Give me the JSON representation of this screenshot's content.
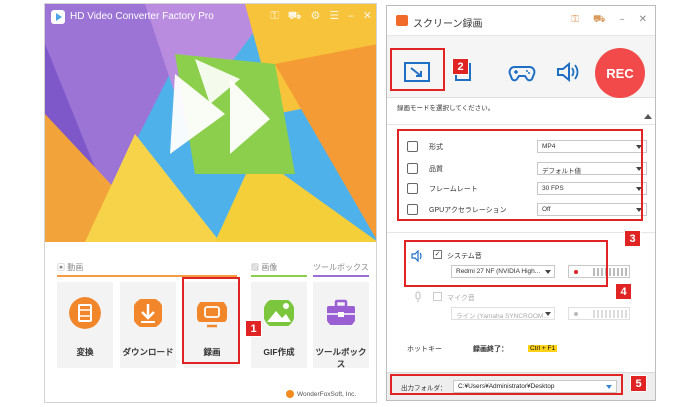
{
  "main_window": {
    "title": "HD Video Converter Factory Pro",
    "toolbar_icons": [
      "key-icon",
      "cart-icon",
      "gear-icon",
      "list-icon",
      "minimize-icon",
      "close-icon"
    ],
    "sections": [
      {
        "label": "動画",
        "color": "#f59b42"
      },
      {
        "label": "画像",
        "color": "#8ccf4c"
      },
      {
        "label": "ツールボックス",
        "color": "#9b6fd6"
      }
    ],
    "cards": [
      {
        "label": "変換",
        "icon": "film-convert-icon",
        "color": "#f2862b"
      },
      {
        "label": "ダウンロード",
        "icon": "download-icon",
        "color": "#f2862b"
      },
      {
        "label": "録画",
        "icon": "screen-record-icon",
        "color": "#f2862b"
      },
      {
        "label": "GIF作成",
        "icon": "image-icon",
        "color": "#7cc63e"
      },
      {
        "label": "ツールボックス",
        "icon": "toolbox-icon",
        "color": "#9b5fd4"
      }
    ],
    "footer": "WonderFoxSoft, Inc."
  },
  "recorder": {
    "title": "スクリーン録画",
    "rec_label": "REC",
    "hint": "録画モードを選択してください。",
    "settings": [
      {
        "label": "形式",
        "value": "MP4",
        "icon": "format-icon"
      },
      {
        "label": "品質",
        "value": "デフォルト値",
        "icon": "quality-icon"
      },
      {
        "label": "フレームレート",
        "value": "30 FPS",
        "icon": "framerate-icon"
      },
      {
        "label": "GPUアクセラレーション",
        "value": "Off",
        "icon": "gpu-icon"
      }
    ],
    "system_audio": {
      "label": "システム音",
      "checked": true,
      "device": "Redmi 27 NF (NVIDIA High..."
    },
    "mic": {
      "label": "マイク音",
      "checked": false,
      "device": "ライン (Yamaha SYNCROOM..."
    },
    "hotkey_label": "ホットキー",
    "stop_label": "録画終了：",
    "stop_shortcut": "Ctrl + F1",
    "output_label": "出力フォルダ：",
    "output_path": "C:¥Users¥Administrator¥Desktop"
  },
  "annotations": [
    "1",
    "2",
    "3",
    "4",
    "5"
  ],
  "colors": {
    "highlight": "#e02424",
    "rec": "#f24a4a",
    "accent": "#f2862b"
  }
}
